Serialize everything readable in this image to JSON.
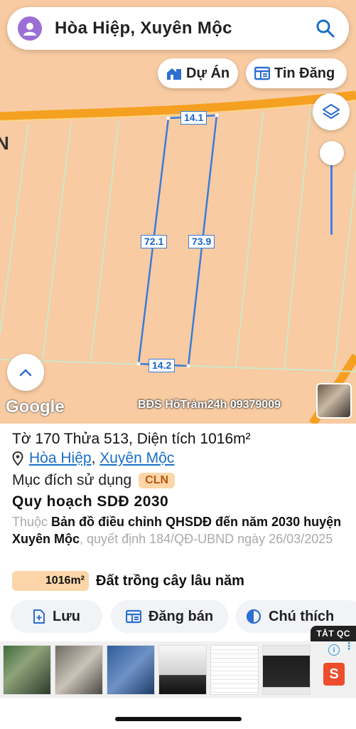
{
  "search": {
    "query": "Hòa Hiệp, Xuyên Mộc"
  },
  "toolbar": {
    "du_an_label": "Dự Án",
    "tin_dang_label": "Tin Đăng"
  },
  "map": {
    "dimensions": [
      "14.1",
      "72.1",
      "73.9",
      "14.2"
    ],
    "attribution": "Google",
    "watermark": "BĐS HồTràm24h 09379009"
  },
  "parcel": {
    "title": "Tờ 170 Thửa 513, Diện tích 1016m²",
    "commune": "Hòa Hiệp",
    "separator": ", ",
    "district": "Xuyên Mộc",
    "purpose_label": "Mục đích sử dụng",
    "purpose_code": "CLN",
    "plan_title": "Quy hoạch SDĐ 2030",
    "plan_prefix": "Thuộc ",
    "plan_map": "Bản đồ điều chỉnh QHSDĐ đến năm 2030 huyện Xuyên Mộc",
    "plan_decision": ", quyết định 184/QĐ-UBND ngày 26/03/2025",
    "area_badge": "1016m²",
    "land_type": "Đất trồng cây lâu năm"
  },
  "actions": {
    "save_label": "Lưu",
    "post_label": "Đăng bán",
    "legend_label": "Chú thích"
  },
  "ad": {
    "tag": "TẮT QC",
    "info": "i"
  },
  "colors": {
    "map_bg": "#f8cba2",
    "road": "#f5a021",
    "parcel_line": "#3a7bdc",
    "accent": "#1a6fc9",
    "badge_bg": "#fcd6a8"
  }
}
